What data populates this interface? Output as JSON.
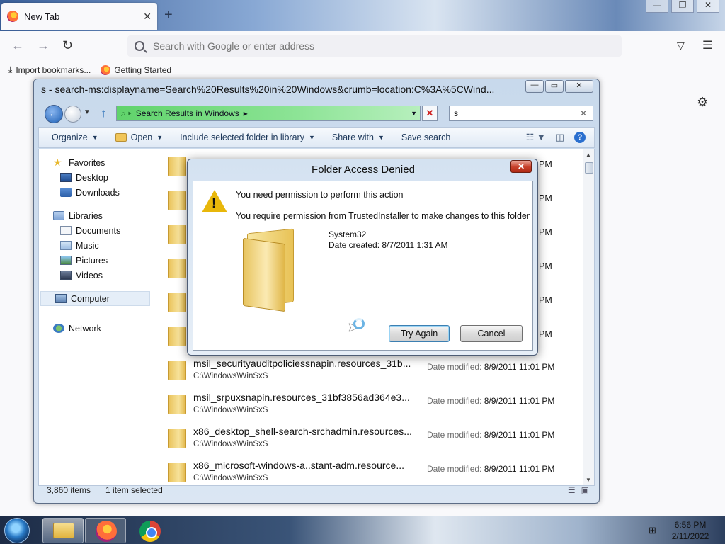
{
  "browser": {
    "tab_title": "New Tab",
    "tab_close": "✕",
    "new_tab": "+",
    "window_controls": {
      "minimize": "—",
      "restore": "❐",
      "close": "✕"
    },
    "nav": {
      "back": "←",
      "forward": "→",
      "reload": "↻"
    },
    "urlbar_placeholder": "Search with Google or enter address",
    "bookmarks": [
      {
        "label": "Import bookmarks...",
        "icon": "import-icon"
      },
      {
        "label": "Getting Started",
        "icon": "firefox-icon"
      }
    ],
    "settings_icon": "⚙"
  },
  "explorer": {
    "title": "s - search-ms:displayname=Search%20Results%20in%20Windows&crumb=location:C%3A%5CWind...",
    "controls": {
      "minimize": "—",
      "maximize": "▭",
      "close": "✕"
    },
    "address": "Search Results in Windows",
    "search_value": "s",
    "toolbar": {
      "organize": "Organize",
      "open": "Open",
      "include": "Include selected folder in library",
      "share": "Share with",
      "save_search": "Save search",
      "help": "?"
    },
    "nav_pane": {
      "favorites": "Favorites",
      "desktop": "Desktop",
      "downloads": "Downloads",
      "libraries": "Libraries",
      "documents": "Documents",
      "music": "Music",
      "pictures": "Pictures",
      "videos": "Videos",
      "computer": "Computer",
      "network": "Network"
    },
    "files": [
      {
        "name": "",
        "path": "",
        "mod_label": "",
        "mod_value": "",
        "pm": "PM"
      },
      {
        "name": "",
        "path": "",
        "mod_label": "",
        "mod_value": "",
        "pm": "PM"
      },
      {
        "name": "",
        "path": "",
        "mod_label": "",
        "mod_value": "",
        "pm": "PM"
      },
      {
        "name": "",
        "path": "",
        "mod_label": "",
        "mod_value": "",
        "pm": "PM"
      },
      {
        "name": "",
        "path": "",
        "mod_label": "",
        "mod_value": "",
        "pm": "PM"
      },
      {
        "name": "",
        "path": "",
        "mod_label": "",
        "mod_value": "",
        "pm": "PM"
      },
      {
        "name": "msil_securityauditpoliciessnapin.resources_31b...",
        "path": "C:\\Windows\\WinSxS",
        "mod_label": "Date modified:",
        "mod_value": "8/9/2011 11:01 PM",
        "pm": ""
      },
      {
        "name": "msil_srpuxsnapin.resources_31bf3856ad364e3...",
        "path": "C:\\Windows\\WinSxS",
        "mod_label": "Date modified:",
        "mod_value": "8/9/2011 11:01 PM",
        "pm": ""
      },
      {
        "name": "x86_desktop_shell-search-srchadmin.resources...",
        "path": "C:\\Windows\\WinSxS",
        "mod_label": "Date modified:",
        "mod_value": "8/9/2011 11:01 PM",
        "pm": ""
      },
      {
        "name": "x86_microsoft-windows-a..stant-adm.resource...",
        "path": "C:\\Windows\\WinSxS",
        "mod_label": "Date modified:",
        "mod_value": "8/9/2011 11:01 PM",
        "pm": ""
      }
    ],
    "status": {
      "count": "3,860 items",
      "selected": "1 item selected"
    }
  },
  "dialog": {
    "title": "Folder Access Denied",
    "close": "✕",
    "message1": "You need permission to perform this action",
    "message2": "You require permission from TrustedInstaller to make changes to this folder",
    "folder_name": "System32",
    "date_created": "Date created: 8/7/2011 1:31 AM",
    "try_again": "Try Again",
    "cancel": "Cancel"
  },
  "taskbar": {
    "time": "6:56 PM",
    "date": "2/11/2022"
  }
}
